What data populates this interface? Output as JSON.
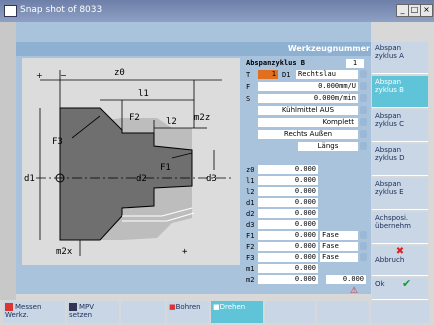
{
  "window": {
    "title": "Snap shot of 8033",
    "minimize": "_",
    "maximize": "□",
    "close": "×"
  },
  "header": {
    "title": "Werkzeugnummer"
  },
  "drawing_labels": {
    "z0": "z0",
    "l1": "l1",
    "l2": "l2",
    "m2z": "m2z",
    "f2": "F2",
    "f3": "F3",
    "f1": "F1",
    "d1": "d1",
    "d2": "d2",
    "d3": "d3",
    "m2x": "m2x",
    "plus": "+",
    "minus": "−",
    "plus2": "+"
  },
  "params": {
    "cycle_label": "Abspanzyklus B",
    "cycle_no": "1",
    "t_label": "T",
    "t_value": "1",
    "d_label": "D1",
    "direction": "Rechtslau",
    "f_label": "F",
    "f_value": "0.000mm/U",
    "s_label": "S",
    "s_value": "0.000m/min",
    "coolant": "Kühlmittel AUS",
    "mode": "Komplett",
    "side": "Rechts Außen",
    "orientation": "Längs",
    "rows": [
      {
        "label": "z0",
        "value": "0.000"
      },
      {
        "label": "l1",
        "value": "0.000"
      },
      {
        "label": "l2",
        "value": "0.000"
      },
      {
        "label": "d1",
        "value": "0.000"
      },
      {
        "label": "d2",
        "value": "0.000"
      },
      {
        "label": "d3",
        "value": "0.000"
      },
      {
        "label": "F1",
        "value": "0.000",
        "extra": "Fase"
      },
      {
        "label": "F2",
        "value": "0.000",
        "extra": "Fase"
      },
      {
        "label": "F3",
        "value": "0.000",
        "extra": "Fase"
      },
      {
        "label": "m1",
        "value": "0.000"
      },
      {
        "label": "m2",
        "value": "0.000",
        "extra": "0.000"
      }
    ]
  },
  "softkeys_right": [
    {
      "label": "Abspan zyklus A",
      "active": false
    },
    {
      "label": "Abspan zyklus B",
      "active": true
    },
    {
      "label": "Abspan zyklus C",
      "active": false
    },
    {
      "label": "Abspan zyklus D",
      "active": false
    },
    {
      "label": "Abspan zyklus E",
      "active": false
    },
    {
      "label": "Achsposi. übernehm",
      "active": false
    },
    {
      "label": "Abbruch",
      "active": false
    },
    {
      "label": "Ok",
      "active": false
    }
  ],
  "softkeys_bottom": [
    {
      "label": "Messen Werkz.",
      "active": false
    },
    {
      "label": "MPV setzen",
      "active": false
    },
    {
      "label": "Bohren",
      "active": false
    },
    {
      "label": "Drehen",
      "active": true
    }
  ],
  "colors": {
    "accent": "#5fc4d8",
    "frame": "#a9c3dc",
    "tool_highlight": "#e07020",
    "part": "#6f6f6f",
    "stock": "#ababab"
  },
  "icons": {
    "cancel": "red-x-icon",
    "ok": "green-check-icon",
    "status": "tool-status-icon"
  }
}
